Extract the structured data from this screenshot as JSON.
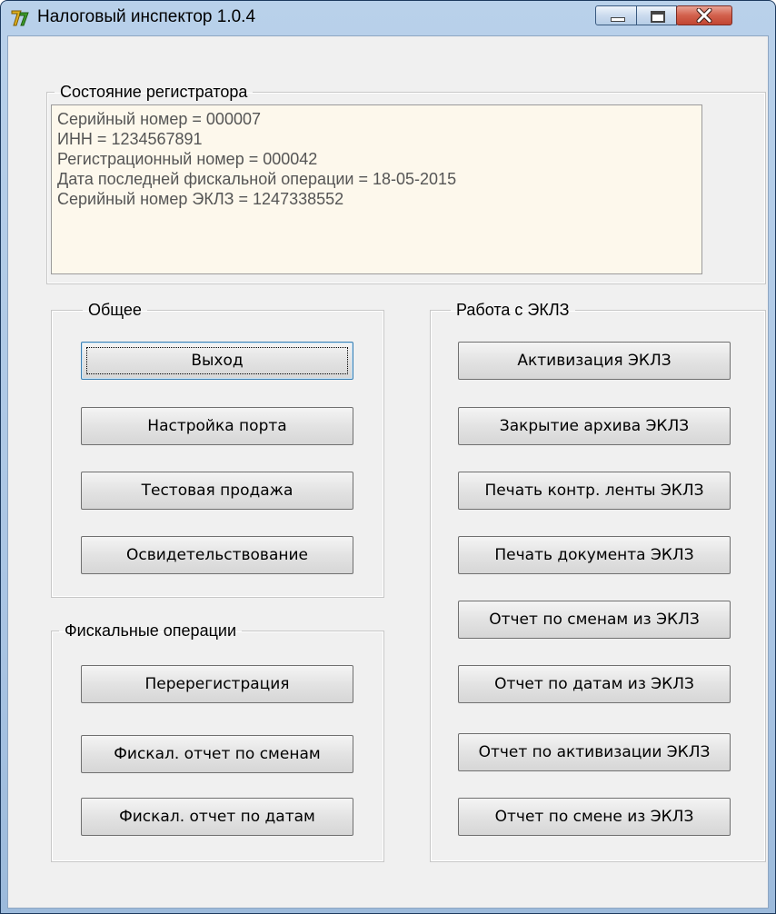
{
  "window": {
    "title": "Налоговый инспектор 1.0.4",
    "icon": "app-icon"
  },
  "registrar": {
    "legend": "Состояние регистратора",
    "lines": [
      "Серийный номер = 000007",
      "ИНН = 1234567891",
      "Регистрационный номер = 000042",
      "Дата последней фискальной операции = 18-05-2015",
      "Серийный номер ЭКЛЗ = 1247338552"
    ]
  },
  "general": {
    "legend": "Общее",
    "buttons": [
      "Выход",
      "Настройка порта",
      "Тестовая продажа",
      "Освидетельствование"
    ]
  },
  "fiscal": {
    "legend": "Фискальные операции",
    "buttons": [
      "Перерегистрация",
      "Фискал. отчет по сменам",
      "Фискал. отчет по датам"
    ]
  },
  "eklz": {
    "legend": "Работа с ЭКЛЗ",
    "buttons": [
      "Активизация ЭКЛЗ",
      "Закрытие архива ЭКЛЗ",
      "Печать контр. ленты ЭКЛЗ",
      "Печать документа ЭКЛЗ",
      "Отчет по сменам из ЭКЛЗ",
      "Отчет по датам из ЭКЛЗ",
      "Отчет по активизации ЭКЛЗ",
      "Отчет по смене из ЭКЛЗ"
    ]
  }
}
